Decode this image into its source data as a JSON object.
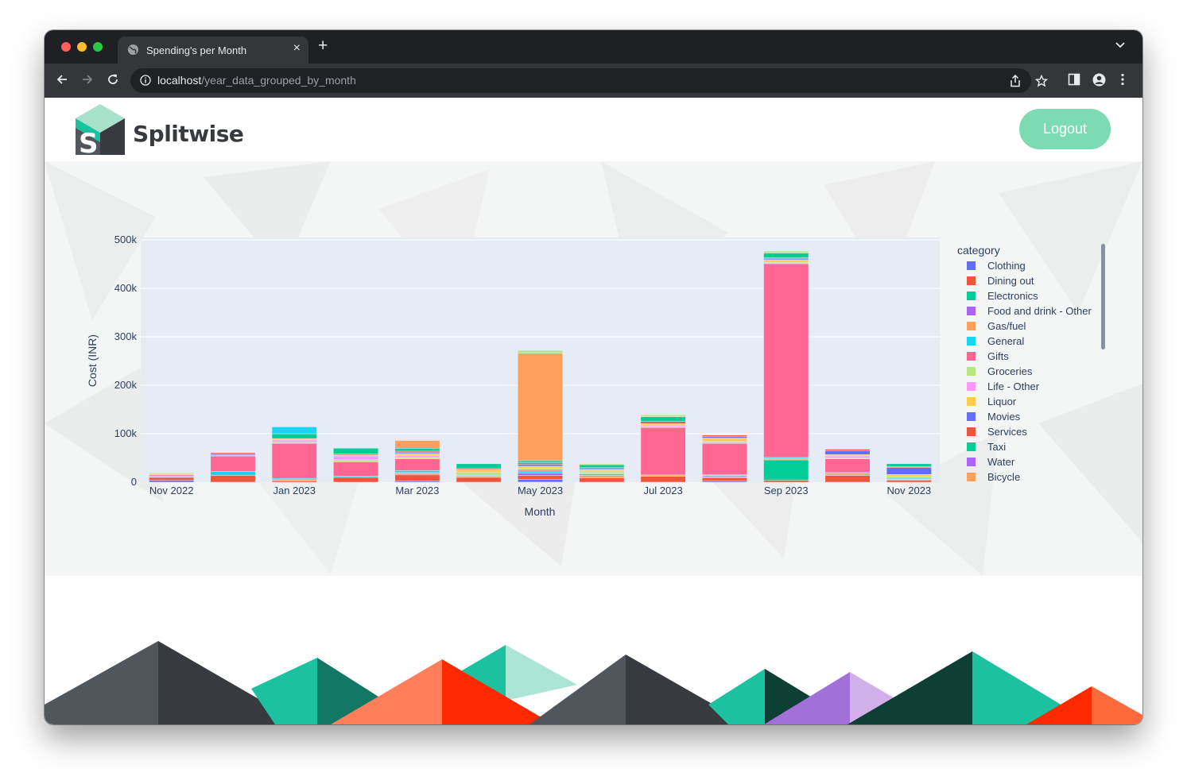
{
  "browser": {
    "tab_title": "Spending's per Month",
    "url_host": "localhost",
    "url_path": "/year_data_grouped_by_month"
  },
  "header": {
    "brand": "Splitwise",
    "logout_label": "Logout"
  },
  "chart_data": {
    "type": "bar",
    "barmode": "stack",
    "title": "",
    "xlabel": "Month",
    "ylabel": "Cost (INR)",
    "ylim": [
      0,
      505000
    ],
    "yticks": [
      0,
      100000,
      200000,
      300000,
      400000,
      500000
    ],
    "ytick_labels": [
      "0",
      "100k",
      "200k",
      "300k",
      "400k",
      "500k"
    ],
    "xtick_labels": [
      "Nov 2022",
      "Jan 2023",
      "Mar 2023",
      "May 2023",
      "Jul 2023",
      "Sep 2023",
      "Nov 2023"
    ],
    "xtick_months": [
      "Nov 2022",
      "Jan 2023",
      "Mar 2023",
      "May 2023",
      "Jul 2023",
      "Sep 2023",
      "Nov 2023"
    ],
    "grid": true,
    "legend_title": "category",
    "legend_position": "right",
    "categories": [
      "Nov 2022",
      "Dec 2022",
      "Jan 2023",
      "Feb 2023",
      "Mar 2023",
      "Apr 2023",
      "May 2023",
      "Jun 2023",
      "Jul 2023",
      "Aug 2023",
      "Sep 2023",
      "Oct 2023",
      "Nov 2023"
    ],
    "series": [
      {
        "name": "Clothing",
        "color": "#636efa",
        "values": [
          4000,
          0,
          0,
          0,
          3000,
          0,
          6000,
          0,
          0,
          3000,
          0,
          0,
          0
        ]
      },
      {
        "name": "Dining out",
        "color": "#ef553b",
        "values": [
          6000,
          14000,
          3000,
          10000,
          12000,
          10000,
          8000,
          9000,
          12000,
          6000,
          4000,
          14000,
          4000
        ]
      },
      {
        "name": "Electronics",
        "color": "#00cc96",
        "values": [
          0,
          0,
          0,
          0,
          0,
          0,
          0,
          0,
          0,
          0,
          42000,
          0,
          0
        ]
      },
      {
        "name": "Food and drink - Other",
        "color": "#ab63fa",
        "values": [
          1000,
          0,
          0,
          0,
          2000,
          0,
          5000,
          0,
          0,
          2000,
          0,
          0,
          0
        ]
      },
      {
        "name": "Gas/fuel",
        "color": "#ffa15a",
        "values": [
          0,
          0,
          2000,
          0,
          3000,
          2000,
          0,
          5000,
          3000,
          3000,
          3000,
          4000,
          2000
        ]
      },
      {
        "name": "General",
        "color": "#19d3f3",
        "values": [
          2000,
          8000,
          3000,
          2000,
          4000,
          2000,
          4000,
          3000,
          0,
          2000,
          2000,
          2000,
          2000
        ]
      },
      {
        "name": "Gifts",
        "color": "#ff6692",
        "values": [
          2000,
          32000,
          72000,
          30000,
          24000,
          0,
          3000,
          0,
          98000,
          64000,
          400000,
          28000,
          0
        ]
      },
      {
        "name": "Groceries",
        "color": "#b6e880",
        "values": [
          2000,
          0,
          3000,
          4000,
          4000,
          6000,
          3000,
          4000,
          2000,
          3000,
          3000,
          2000,
          4000
        ]
      },
      {
        "name": "Life - Other",
        "color": "#ff97ff",
        "values": [
          0,
          2000,
          4000,
          8000,
          3000,
          0,
          0,
          2000,
          3000,
          2000,
          0,
          4000,
          0
        ]
      },
      {
        "name": "Liquor",
        "color": "#fecb52",
        "values": [
          2000,
          0,
          3000,
          2000,
          4000,
          6000,
          4000,
          3000,
          3000,
          6000,
          5000,
          3000,
          4000
        ]
      },
      {
        "name": "Movies",
        "color": "#636efa",
        "values": [
          0,
          3000,
          0,
          0,
          2000,
          0,
          4000,
          2000,
          0,
          3000,
          2000,
          8000,
          14000
        ]
      },
      {
        "name": "Services",
        "color": "#ef553b",
        "values": [
          0,
          2000,
          0,
          2000,
          3000,
          2000,
          3000,
          2000,
          4000,
          3000,
          2000,
          3000,
          2000
        ]
      },
      {
        "name": "Taxi",
        "color": "#00cc96",
        "values": [
          0,
          0,
          10000,
          12000,
          6000,
          10000,
          4000,
          6000,
          10000,
          0,
          10000,
          0,
          6000
        ]
      },
      {
        "name": "Water",
        "color": "#ab63fa",
        "values": [
          0,
          0,
          0,
          0,
          0,
          0,
          0,
          0,
          0,
          0,
          0,
          0,
          0
        ]
      },
      {
        "name": "Bicycle",
        "color": "#ffa15a",
        "values": [
          0,
          0,
          0,
          0,
          16000,
          0,
          222000,
          0,
          0,
          0,
          0,
          0,
          0
        ]
      },
      {
        "name": "",
        "color": "#19d3f3",
        "values": [
          0,
          0,
          14000,
          0,
          0,
          0,
          0,
          0,
          0,
          0,
          0,
          0,
          0
        ]
      },
      {
        "name": "",
        "color": "#b6e880",
        "values": [
          0,
          0,
          0,
          0,
          0,
          0,
          6000,
          2000,
          4000,
          0,
          4000,
          0,
          0
        ]
      },
      {
        "name": "",
        "color": "#ff6692",
        "values": [
          0,
          0,
          0,
          0,
          0,
          0,
          0,
          0,
          0,
          0,
          0,
          0,
          0
        ]
      }
    ]
  }
}
